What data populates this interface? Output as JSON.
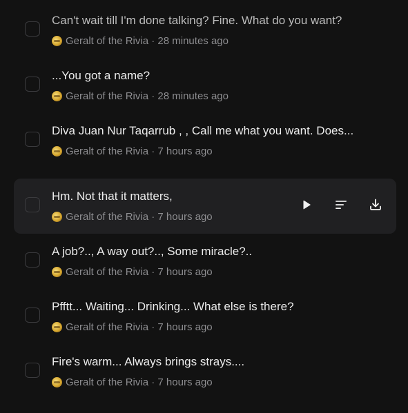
{
  "messages": [
    {
      "title": "Can't wait till I'm done talking? Fine. What do you want?",
      "author": "Geralt of the Rivia",
      "separator": "·",
      "time": "28 minutes ago"
    },
    {
      "title": "...You got a name?",
      "author": "Geralt of the Rivia",
      "separator": "·",
      "time": "28 minutes ago"
    },
    {
      "title": "Diva Juan Nur Taqarrub , , Call me what you want. Does...",
      "author": "Geralt of the Rivia",
      "separator": "·",
      "time": "7 hours ago"
    },
    {
      "title": "Hm. Not that it matters,",
      "author": "Geralt of the Rivia",
      "separator": "·",
      "time": "7 hours ago"
    },
    {
      "title": "A job?.., A way out?.., Some miracle?..",
      "author": "Geralt of the Rivia",
      "separator": "·",
      "time": "7 hours ago"
    },
    {
      "title": "Pfftt... Waiting... Drinking... What else is there?",
      "author": "Geralt of the Rivia",
      "separator": "·",
      "time": "7 hours ago"
    },
    {
      "title": "Fire's warm... Always brings strays....",
      "author": "Geralt of the Rivia",
      "separator": "·",
      "time": "7 hours ago"
    }
  ],
  "hovered_actions": {
    "play_icon": "play-icon",
    "transcript_icon": "text-lines-icon",
    "download_icon": "download-icon"
  },
  "colors": {
    "background": "#121212",
    "hover_row": "#202022",
    "text_primary": "#ececec",
    "text_muted": "#8d8d90"
  }
}
